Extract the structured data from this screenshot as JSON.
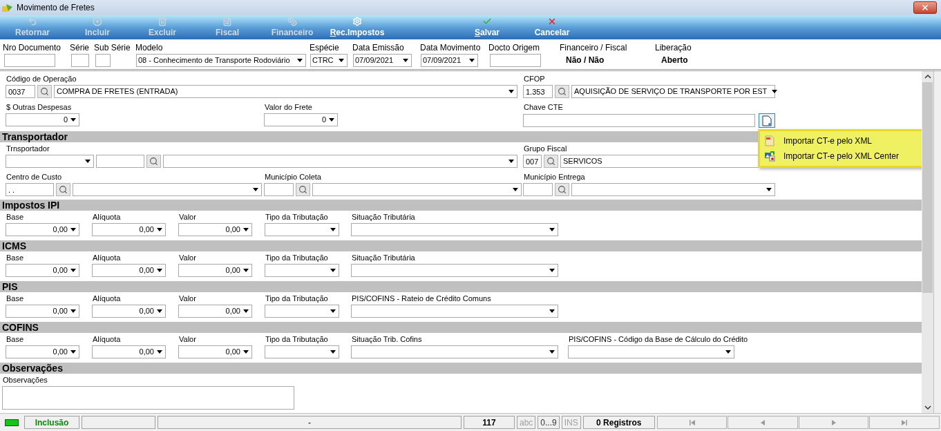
{
  "window": {
    "title": "Movimento de Fretes"
  },
  "toolbar": {
    "groups": [
      [
        {
          "label": "Retornar",
          "disabled": true,
          "mnemonic": false
        },
        {
          "label": "Incluir",
          "disabled": true,
          "mnemonic": false
        },
        {
          "label": "Excluir",
          "disabled": true,
          "mnemonic": false
        },
        {
          "label": "Fiscal",
          "disabled": true,
          "mnemonic": false
        },
        {
          "label": "Financeiro",
          "disabled": true,
          "mnemonic": false
        },
        {
          "label": "Rec.Impostos",
          "disabled": false,
          "mnemonic": true
        }
      ],
      [
        {
          "label": "Salvar",
          "disabled": false,
          "mnemonic": true
        },
        {
          "label": "Cancelar",
          "disabled": false,
          "mnemonic": false
        }
      ]
    ]
  },
  "header": [
    {
      "label": "Nro Documento",
      "kind": "text"
    },
    {
      "label": "Série",
      "kind": "text"
    },
    {
      "label": "Sub Série",
      "kind": "text"
    },
    {
      "label": "Modelo",
      "kind": "select",
      "value": "08 - Conhecimento de Transporte Rodoviário"
    },
    {
      "label": "Espécie",
      "kind": "select",
      "value": "CTRC"
    },
    {
      "label": "Data Emissão",
      "kind": "select",
      "value": "07/09/2021"
    },
    {
      "label": "Data Movimento",
      "kind": "select",
      "value": "07/09/2021"
    },
    {
      "label": "Docto Origem",
      "kind": "text"
    },
    {
      "label": "Financeiro / Fiscal",
      "kind": "static",
      "value": "Não / Não"
    },
    {
      "label": "Liberação",
      "kind": "static",
      "value": "Aberto"
    }
  ],
  "form": {
    "sections": [
      {
        "rows": [
          {
            "kind": "wide",
            "cells": [
              {
                "label": "Código de Operação",
                "parts": [
                  {
                    "kind": "code",
                    "value": "0037"
                  },
                  {
                    "kind": "lookup"
                  },
                  {
                    "kind": "select",
                    "value": "COMPRA DE FRETES (ENTRADA)"
                  }
                ]
              },
              "",
              {
                "label": "CFOP",
                "parts": [
                  {
                    "kind": "code",
                    "value": "1.353"
                  },
                  {
                    "kind": "lookup"
                  },
                  {
                    "kind": "select",
                    "value": "AQUISIÇÃO DE SERVIÇO DE TRANSPORTE POR EST"
                  }
                ]
              }
            ]
          },
          {
            "kind": "thirds",
            "cells": [
              {
                "label": "$ Outras Despesas",
                "parts": [
                  {
                    "kind": "numeric",
                    "value": "0"
                  }
                ]
              },
              {
                "label": "Valor do Frete",
                "parts": [
                  {
                    "kind": "numeric",
                    "value": "0"
                  }
                ]
              },
              {
                "label": "Chave CTE",
                "parts": [
                  {
                    "kind": "field"
                  },
                  {
                    "kind": "import",
                    "expanded": true,
                    "menu": [
                      {
                        "label": "Importar CT-e pelo XML"
                      },
                      {
                        "label": "Importar CT-e pelo XML Center"
                      }
                    ]
                  }
                ]
              }
            ]
          }
        ]
      },
      {
        "title": "Transportador",
        "rows": [
          {
            "kind": "wide",
            "cells": [
              {
                "label": "Trnsportador",
                "parts": [
                  {
                    "kind": "combo"
                  },
                  {
                    "kind": "text"
                  },
                  {
                    "kind": "lookup"
                  },
                  {
                    "kind": "select"
                  }
                ]
              },
              "",
              {
                "label": "Grupo Fiscal",
                "parts": [
                  {
                    "kind": "small",
                    "value": "007"
                  },
                  {
                    "kind": "lookup"
                  },
                  {
                    "kind": "select",
                    "value": "SERVICOS"
                  }
                ]
              }
            ]
          },
          {
            "kind": "thirds",
            "cells": [
              {
                "label": "Centro de Custo",
                "parts": [
                  {
                    "kind": "text",
                    "value": ". ."
                  },
                  {
                    "kind": "lookup"
                  },
                  {
                    "kind": "select"
                  }
                ]
              },
              {
                "label": "Município Coleta",
                "parts": [
                  {
                    "kind": "code"
                  },
                  {
                    "kind": "lookup"
                  },
                  {
                    "kind": "select"
                  }
                ]
              },
              {
                "label": "Município Entrega",
                "parts": [
                  {
                    "kind": "code"
                  },
                  {
                    "kind": "lookup"
                  },
                  {
                    "kind": "select"
                  }
                ]
              }
            ]
          }
        ]
      },
      {
        "title": "Impostos IPI",
        "rows": [
          {
            "kind": "tax",
            "cells": [
              {
                "label": "Base",
                "parts": [
                  {
                    "kind": "numeric",
                    "value": "0,00"
                  }
                ]
              },
              {
                "label": "Alíquota",
                "parts": [
                  {
                    "kind": "numeric",
                    "value": "0,00"
                  }
                ]
              },
              {
                "label": "Valor",
                "parts": [
                  {
                    "kind": "numeric",
                    "value": "0,00"
                  }
                ]
              },
              {
                "label": "Tipo da Tributação",
                "parts": [
                  {
                    "kind": "select"
                  }
                ]
              },
              {
                "label": "Situação Tributária",
                "parts": [
                  {
                    "kind": "select"
                  }
                ]
              }
            ]
          }
        ]
      },
      {
        "title": "ICMS",
        "rows": [
          {
            "kind": "tax",
            "cells": [
              {
                "label": "Base",
                "parts": [
                  {
                    "kind": "numeric",
                    "value": "0,00"
                  }
                ]
              },
              {
                "label": "Alíquota",
                "parts": [
                  {
                    "kind": "numeric",
                    "value": "0,00"
                  }
                ]
              },
              {
                "label": "Valor",
                "parts": [
                  {
                    "kind": "numeric",
                    "value": "0,00"
                  }
                ]
              },
              {
                "label": "Tipo da Tributação",
                "parts": [
                  {
                    "kind": "select"
                  }
                ]
              },
              {
                "label": "Situação Tributária",
                "parts": [
                  {
                    "kind": "select"
                  }
                ]
              }
            ]
          }
        ]
      },
      {
        "title": "PIS",
        "rows": [
          {
            "kind": "tax",
            "cells": [
              {
                "label": "Base",
                "parts": [
                  {
                    "kind": "numeric",
                    "value": "0,00"
                  }
                ]
              },
              {
                "label": "Alíquota",
                "parts": [
                  {
                    "kind": "numeric",
                    "value": "0,00"
                  }
                ]
              },
              {
                "label": "Valor",
                "parts": [
                  {
                    "kind": "numeric",
                    "value": "0,00"
                  }
                ]
              },
              {
                "label": "Tipo da Tributação",
                "parts": [
                  {
                    "kind": "select"
                  }
                ]
              },
              {
                "label": "PIS/COFINS - Rateio de Crédito Comuns",
                "parts": [
                  {
                    "kind": "select"
                  }
                ]
              }
            ]
          }
        ]
      },
      {
        "title": "COFINS",
        "rows": [
          {
            "kind": "tax",
            "cells": [
              {
                "label": "Base",
                "parts": [
                  {
                    "kind": "numeric",
                    "value": "0,00"
                  }
                ]
              },
              {
                "label": "Alíquota",
                "parts": [
                  {
                    "kind": "numeric",
                    "value": "0,00"
                  }
                ]
              },
              {
                "label": "Valor",
                "parts": [
                  {
                    "kind": "numeric",
                    "value": "0,00"
                  }
                ]
              },
              {
                "label": "Tipo da Tributação",
                "parts": [
                  {
                    "kind": "select"
                  }
                ]
              },
              {
                "label": "Situação Trib. Cofins",
                "parts": [
                  {
                    "kind": "select"
                  }
                ]
              },
              {
                "label": "PIS/COFINS - Código da Base de Cálculo do Crédito",
                "parts": [
                  {
                    "kind": "select"
                  }
                ]
              }
            ]
          }
        ]
      },
      {
        "title": "Observações",
        "rows": [
          {
            "kind": "notes",
            "cells": [
              {
                "label": "Observações",
                "parts": [
                  {
                    "kind": "textarea"
                  }
                ]
              }
            ]
          }
        ]
      }
    ]
  },
  "status_bar": [
    {
      "kind": "led"
    },
    {
      "kind": "mode",
      "text": "Inclusão"
    },
    {
      "kind": "blank"
    },
    {
      "kind": "text",
      "text": "-"
    },
    {
      "kind": "count",
      "text": "117"
    },
    {
      "kind": "flag",
      "text": "abc",
      "disabled": true
    },
    {
      "kind": "flag",
      "text": "0...9",
      "disabled": false
    },
    {
      "kind": "flag",
      "text": "INS",
      "disabled": true
    },
    {
      "kind": "count",
      "text": "0 Registros"
    },
    {
      "kind": "nav",
      "disabled": true
    }
  ]
}
